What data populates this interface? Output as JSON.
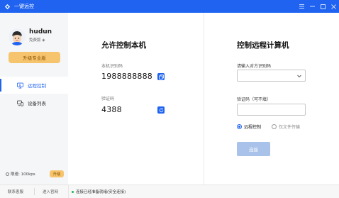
{
  "window": {
    "title": "一键远控",
    "controls": [
      "menu-icon",
      "minimize-icon",
      "maximize-icon",
      "close-icon"
    ]
  },
  "sidebar": {
    "username": "hudun",
    "tier": "免费版 ◈",
    "upgrade_label": "升级专业版",
    "items": [
      {
        "label": "远程控制",
        "icon": "remote-control-icon",
        "active": true
      },
      {
        "label": "设备列表",
        "icon": "device-list-icon",
        "active": false
      }
    ],
    "speed_limit": "限速: 100kps",
    "speed_upgrade": "升级"
  },
  "allow": {
    "heading": "允许控制本机",
    "id_label": "本机识别码",
    "id_value": "1988888888",
    "code_label": "验证码",
    "code_value": "4388"
  },
  "control": {
    "heading": "控制远程计算机",
    "peer_label": "请输入对方识别码",
    "peer_value": "",
    "code_label": "验证码（可不填）",
    "code_value": "",
    "mode_remote": "远程控制",
    "mode_file": "仅文件传输",
    "selected_mode": "远程控制",
    "connect_label": "连接"
  },
  "footer": {
    "contact": "联系客服",
    "website": "进入官网",
    "status": "连接已经准备就绪(安全连接)"
  },
  "colors": {
    "brand": "#1f63f0",
    "gold": "#f7c46e",
    "status_ok": "#21b24b",
    "connect_disabled": "#a9c2e9"
  }
}
